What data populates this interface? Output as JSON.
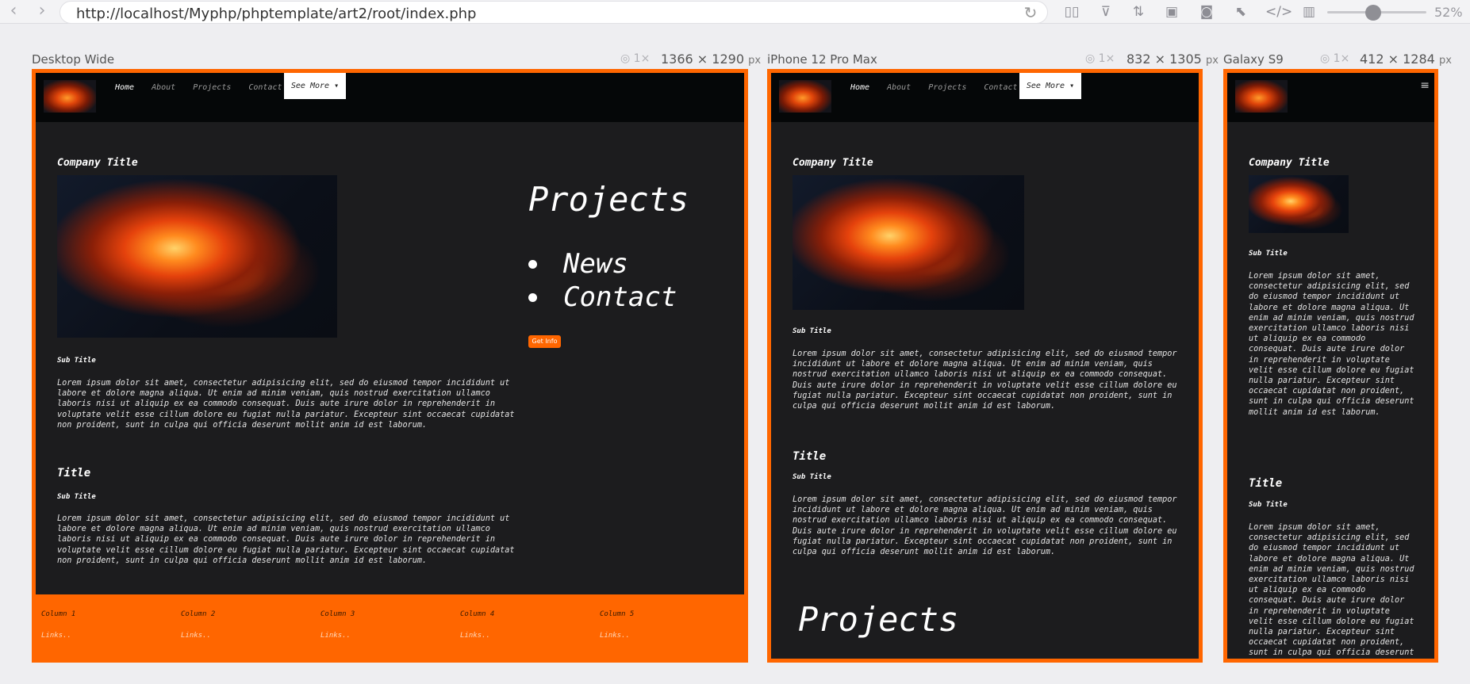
{
  "browser": {
    "back_icon": "chevron-left-icon",
    "forward_icon": "chevron-right-icon",
    "url": "http://localhost/Myphp/phptemplate/art2/root/index.php",
    "zoom": "52%"
  },
  "devices": [
    {
      "name": "Desktop Wide",
      "scale": "1×",
      "width": "1366",
      "height": "1290",
      "unit": "px"
    },
    {
      "name": "iPhone 12 Pro Max",
      "scale": "1×",
      "width": "832",
      "height": "1305",
      "unit": "px"
    },
    {
      "name": "Galaxy S9",
      "scale": "1×",
      "width": "412",
      "height": "1284",
      "unit": "px"
    }
  ],
  "site": {
    "nav": [
      "Home",
      "About",
      "Projects",
      "Contact"
    ],
    "see_more": "See More ▾",
    "company_title": "Company Title",
    "sub_title": "Sub Title",
    "title": "Title",
    "lorem": "Lorem ipsum dolor sit amet, consectetur adipisicing elit, sed do eiusmod tempor incididunt ut labore et dolore magna aliqua. Ut enim ad minim veniam, quis nostrud exercitation ullamco laboris nisi ut aliquip ex ea commodo consequat. Duis aute irure dolor in reprehenderit in voluptate velit esse cillum dolore eu fugiat nulla pariatur. Excepteur sint occaecat cupidatat non proident, sunt in culpa qui officia deserunt mollit anim id est laborum.",
    "sidebar_title": "Projects",
    "sidebar_items": [
      "News",
      "Contact"
    ],
    "get_info": "Get Info",
    "footer_columns": [
      "Column 1",
      "Column 2",
      "Column 3",
      "Column 4",
      "Column 5"
    ],
    "footer_links": "Links.."
  },
  "colors": {
    "accent": "#ff6600",
    "page_bg": "#1c1c1e",
    "nav_bg": "#050708"
  }
}
